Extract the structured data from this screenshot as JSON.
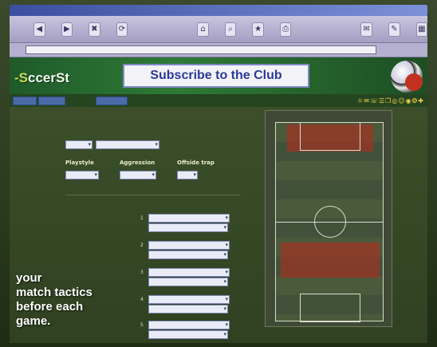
{
  "browser": {
    "title": "",
    "toolbar_buttons": [
      "◀",
      "▶",
      "✖",
      "⟳",
      "⌂",
      "⌕",
      "★",
      "⎙",
      "✉",
      "✎",
      "▦"
    ],
    "address_value": ""
  },
  "site": {
    "logo_prefix": "-S",
    "logo_text": "ccerSt",
    "banner_text": "Subscribe to the Club"
  },
  "nav": {
    "tabs": [
      "",
      "",
      ""
    ],
    "icons": "☼✉☏☰❐◎☺◉❂✚"
  },
  "tactics": {
    "top_tabs": [
      "",
      "",
      ""
    ],
    "labels": {
      "playstyle": "Playstyle",
      "aggression": "Aggression",
      "offside_trap": "Offside trap"
    },
    "selects": {
      "team_a": "",
      "team_b": "",
      "playstyle": "",
      "aggression": "",
      "offside_trap": ""
    },
    "player_rows": [
      {
        "num": "1",
        "a": "",
        "b": ""
      },
      {
        "num": "2",
        "a": "",
        "b": ""
      },
      {
        "num": "3",
        "a": "",
        "b": ""
      },
      {
        "num": "4",
        "a": "",
        "b": ""
      },
      {
        "num": "5",
        "a": "",
        "b": ""
      }
    ]
  },
  "caption": {
    "hl": "",
    "line1": "your",
    "line2": "match tactics",
    "line3": "before each",
    "line4": "game."
  },
  "colors": {
    "banner_text": "#2b3a9a",
    "header_green": "#2e7a36",
    "nav_tab": "#4b6aa8"
  }
}
